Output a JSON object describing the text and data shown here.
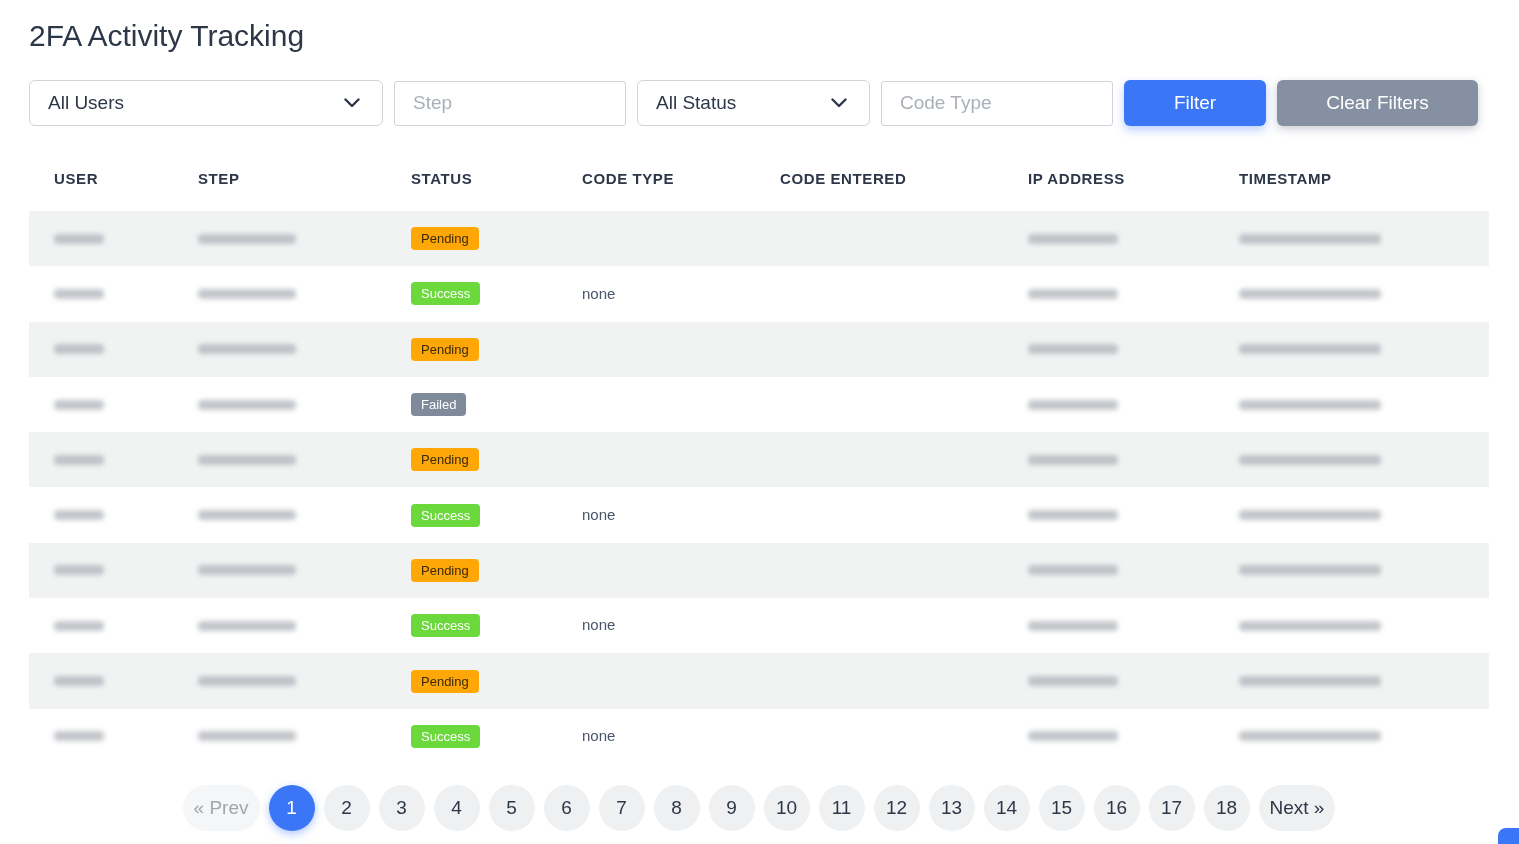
{
  "title": "2FA Activity Tracking",
  "filters": {
    "user_select": {
      "value": "All Users"
    },
    "step": {
      "placeholder": "Step"
    },
    "status_select": {
      "value": "All Status"
    },
    "code_type": {
      "placeholder": "Code Type"
    },
    "buttons": [
      {
        "label": "Filter",
        "kind": "primary"
      },
      {
        "label": "Clear Filters",
        "kind": "secondary"
      }
    ]
  },
  "table": {
    "columns": [
      "USER",
      "STEP",
      "STATUS",
      "CODE TYPE",
      "CODE ENTERED",
      "IP ADDRESS",
      "TIMESTAMP"
    ],
    "rows": [
      {
        "status": {
          "label": "Pending",
          "kind": "pending"
        }
      },
      {
        "status": {
          "label": "Success",
          "kind": "success"
        },
        "code_type": "none"
      },
      {
        "status": {
          "label": "Pending",
          "kind": "pending"
        }
      },
      {
        "status": {
          "label": "Failed",
          "kind": "failed"
        }
      },
      {
        "status": {
          "label": "Pending",
          "kind": "pending"
        }
      },
      {
        "status": {
          "label": "Success",
          "kind": "success"
        },
        "code_type": "none"
      },
      {
        "status": {
          "label": "Pending",
          "kind": "pending"
        }
      },
      {
        "status": {
          "label": "Success",
          "kind": "success"
        },
        "code_type": "none"
      },
      {
        "status": {
          "label": "Pending",
          "kind": "pending"
        }
      },
      {
        "status": {
          "label": "Success",
          "kind": "success"
        },
        "code_type": "none"
      }
    ]
  },
  "pagination": {
    "prev": {
      "label": "« Prev",
      "disabled": true
    },
    "pages": [
      {
        "label": "1",
        "selected": true
      },
      {
        "label": "2",
        "selected": false
      },
      {
        "label": "3",
        "selected": false
      },
      {
        "label": "4",
        "selected": false
      },
      {
        "label": "5",
        "selected": false
      },
      {
        "label": "6",
        "selected": false
      },
      {
        "label": "7",
        "selected": false
      },
      {
        "label": "8",
        "selected": false
      },
      {
        "label": "9",
        "selected": false
      },
      {
        "label": "10",
        "selected": false
      },
      {
        "label": "11",
        "selected": false
      },
      {
        "label": "12",
        "selected": false
      },
      {
        "label": "13",
        "selected": false
      },
      {
        "label": "14",
        "selected": false
      },
      {
        "label": "15",
        "selected": false
      },
      {
        "label": "16",
        "selected": false
      },
      {
        "label": "17",
        "selected": false
      },
      {
        "label": "18",
        "selected": false
      }
    ],
    "next": {
      "label": "Next »",
      "disabled": false
    }
  }
}
